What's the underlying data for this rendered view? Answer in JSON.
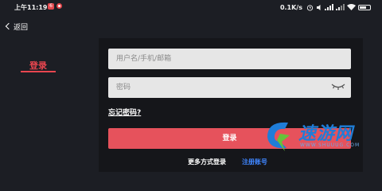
{
  "status_bar": {
    "time": "上午11:19",
    "badge": "6",
    "net_speed": "0.1K/s"
  },
  "nav": {
    "back_label": "返回"
  },
  "sidebar": {
    "login_tab": "登录"
  },
  "form": {
    "username_placeholder": "用户名/手机/邮箱",
    "password_placeholder": "密码",
    "forgot_password": "忘记密码?",
    "login_button": "登录",
    "more_login": "更多方式登录",
    "register": "注册账号"
  },
  "watermark": {
    "text": "速游网",
    "url": "WWW.SHUUUG.COM"
  },
  "colors": {
    "accent": "#e9464f",
    "button": "#e6525c",
    "link": "#3f86ff",
    "background": "#1c1e24",
    "panel": "#15161a"
  }
}
